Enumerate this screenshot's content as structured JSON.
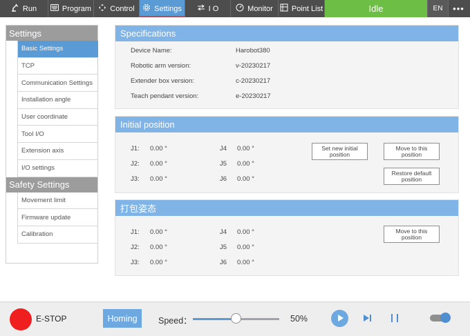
{
  "topbar": {
    "tabs": [
      {
        "label": "Run",
        "icon": "robot-arm-icon"
      },
      {
        "label": "Program",
        "icon": "keyboard-icon"
      },
      {
        "label": "Control",
        "icon": "move-arrows-icon"
      },
      {
        "label": "Settings",
        "icon": "gear-icon",
        "active": true
      },
      {
        "label": "I  O",
        "icon": "io-icon"
      },
      {
        "label": "Monitor",
        "icon": "gauge-icon"
      },
      {
        "label": "Point List",
        "icon": "point-list-icon"
      }
    ],
    "status": "Idle",
    "status_color": "#6dbe45",
    "lang": "EN",
    "more": "•••"
  },
  "sidebar": {
    "settings_title": "Settings",
    "settings_items": [
      "Basic Settings",
      "TCP",
      "Communication Settings",
      "Installation angle",
      "User coordinate",
      "Tool I/O",
      "Extension axis",
      "I/O settings"
    ],
    "safety_title": "Safety Settings",
    "safety_items": [
      "Movement limit",
      "Firmware update",
      "Calibration"
    ]
  },
  "specs": {
    "title": "Specifications",
    "rows": [
      {
        "label": "Device Name:",
        "value": "Harobot380"
      },
      {
        "label": "Robotic arm version:",
        "value": "v-20230217"
      },
      {
        "label": "Extender box version:",
        "value": "c-20230217"
      },
      {
        "label": "Teach pendant version:",
        "value": "e-20230217"
      }
    ]
  },
  "initial": {
    "title": "Initial position",
    "j1": "J1:",
    "j1_val": "0.00 °",
    "j2": "J2:",
    "j2_val": "0.00 °",
    "j3": "J3:",
    "j3_val": "0.00 °",
    "j4": "J4",
    "j4_val": "0.00 °",
    "j5": "J5",
    "j5_val": "0.00 °",
    "j6": "J6",
    "j6_val": "0.00 °",
    "btn_set_new": "Set new initial position",
    "btn_move": "Move to this position",
    "btn_restore": "Restore default position"
  },
  "packing": {
    "title": "打包姿态",
    "j1": "J1:",
    "j1_val": "0.00 °",
    "j2": "J2:",
    "j2_val": "0.00 °",
    "j3": "J3:",
    "j3_val": "0.00 °",
    "j4": "J4",
    "j4_val": "0.00 °",
    "j5": "J5",
    "j5_val": "0.00 °",
    "j6": "J6",
    "j6_val": "0.00 °",
    "btn_move": "Move to this position"
  },
  "bottom": {
    "estop": "E-STOP",
    "homing": "Homing",
    "speed_label": "Speed：",
    "speed_value": "50%",
    "speed_fraction": 0.5,
    "accent_color": "#5b9bd5"
  }
}
